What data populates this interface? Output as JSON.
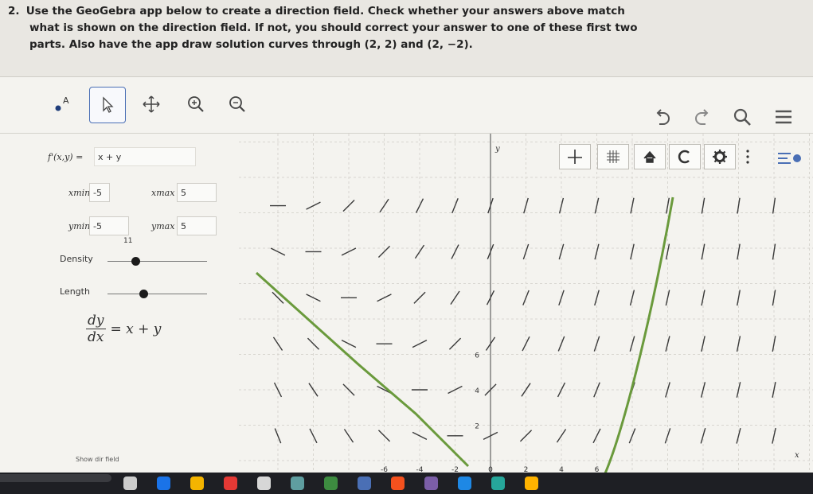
{
  "problem": {
    "number": "2.",
    "line1": "Use the GeoGebra app below to create a direction field. Check whether your answers above match",
    "line2": "what is shown on the direction field. If not, you should correct your answer to one of these first two",
    "line3": "parts. Also have the app draw solution curves through (2, 2) and (2, −2)."
  },
  "app": {
    "function_label": "f'(x,y) =",
    "function_value": "x + y",
    "xmin_label": "xmin",
    "xmin_value": "-5",
    "xmax_label": "xmax",
    "xmax_value": "5",
    "ymin_label": "ymin",
    "ymin_value": "-5",
    "ymax_label": "ymax",
    "ymax_value": "5",
    "density_label": "Density",
    "density_min": "11",
    "length_label": "Length",
    "ode_numerator": "dy",
    "ode_denominator": "dx",
    "ode_rhs": "= x + y",
    "bottom_partial": "Show dir field",
    "density_value_fraction": 0.28,
    "length_value_fraction": 0.36
  },
  "toolbar_icons": [
    "point-tool-icon",
    "select-arrow-icon",
    "move-graphics-icon",
    "zoom-in-icon",
    "zoom-out-icon"
  ],
  "right_icons": [
    "undo-icon",
    "redo-icon",
    "search-icon",
    "menu-icon"
  ],
  "graph_toolbar_icons": [
    "axes-icon",
    "grid-icon",
    "home-icon",
    "reset-icon",
    "settings-icon",
    "more-icon",
    "style-bar-icon"
  ],
  "graph": {
    "axis_x_label": "x",
    "axis_y_label": "y",
    "x_ticks": [
      "-6",
      "-4",
      "-2",
      "0",
      "2",
      "4",
      "6"
    ],
    "y_ticks": [
      "6",
      "4",
      "2"
    ],
    "curve_color": "#6a9a3c",
    "curves": [
      {
        "name": "solution through (2, -2)",
        "through": [
          2,
          -2
        ]
      },
      {
        "name": "solution through (2, 2)",
        "through": [
          2,
          2
        ]
      }
    ]
  },
  "colors": {
    "accent": "#4a6fb5",
    "curve": "#6a9a3c"
  }
}
